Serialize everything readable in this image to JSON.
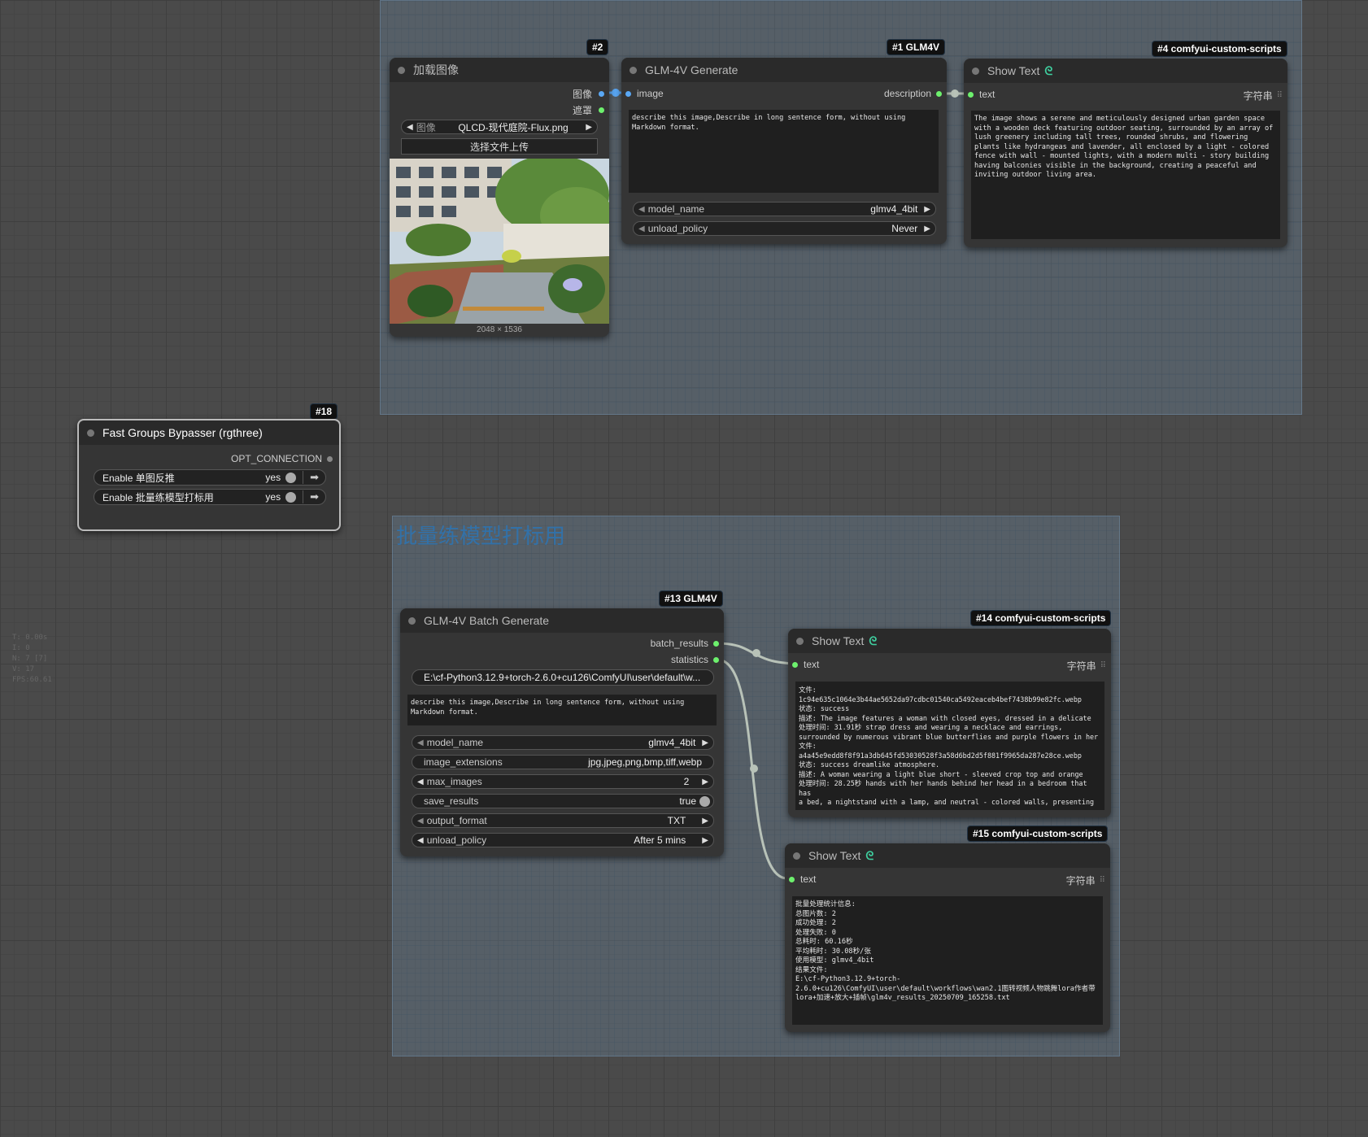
{
  "colors": {
    "wire": "#b8c2b8",
    "group_bg": "#7896b4",
    "link_green": "#6df06d",
    "link_blue": "#5aa8f5"
  },
  "stats": [
    "T: 0.00s",
    "I: 0",
    "N: 7 [7]",
    "V: 17",
    "FPS:60.61"
  ],
  "group_bottom": {
    "title": "批量练模型打标用"
  },
  "node_load_image": {
    "badge": "#2",
    "title": "加载图像",
    "out_image": "图像",
    "out_mask": "遮罩",
    "image_label": "图像",
    "image_value": "QLCD-现代庭院-Flux.png",
    "upload_button": "选择文件上传",
    "dimensions": "2048 × 1536"
  },
  "node_glm_generate": {
    "badge": "#1 GLM4V",
    "title": "GLM-4V Generate",
    "in_image": "image",
    "out_description": "description",
    "prompt": "describe this image,Describe in long sentence form, without using Markdown format.",
    "model_label": "model_name",
    "model_value": "glmv4_4bit",
    "unload_label": "unload_policy",
    "unload_value": "Never"
  },
  "node_show_text_4": {
    "badge": "#4 comfyui-custom-scripts",
    "title": "Show Text",
    "icon": "snake-icon",
    "in_text": "text",
    "type_label": "字符串",
    "content": "The image shows a serene and meticulously designed urban garden space with a wooden deck featuring outdoor seating, surrounded by an array of lush greenery including tall trees, rounded shrubs, and flowering plants like hydrangeas and lavender, all enclosed by a light - colored fence with wall - mounted lights, with a modern multi - story building having balconies visible in the background, creating a peaceful and inviting outdoor living area."
  },
  "node_bypasser": {
    "badge": "#18",
    "title": "Fast Groups Bypasser (rgthree)",
    "out_opt": "OPT_CONNECTION",
    "rows": [
      {
        "label": "Enable 单图反推",
        "value": "yes"
      },
      {
        "label": "Enable 批量练模型打标用",
        "value": "yes"
      }
    ]
  },
  "node_batch": {
    "badge": "#13 GLM4V",
    "title": "GLM-4V Batch Generate",
    "out_batch": "batch_results",
    "out_stats": "statistics",
    "path": "E:\\cf-Python3.12.9+torch-2.6.0+cu126\\ComfyUI\\user\\default\\w...",
    "prompt": "describe this image,Describe in long sentence form, without using Markdown format.",
    "widgets": [
      {
        "label": "model_name",
        "value": "glmv4_4bit",
        "type": "combo"
      },
      {
        "label": "image_extensions",
        "value": "jpg,jpeg,png,bmp,tiff,webp",
        "type": "text"
      },
      {
        "label": "max_images",
        "value": "2",
        "type": "number"
      },
      {
        "label": "save_results",
        "value": "true",
        "type": "toggle"
      },
      {
        "label": "output_format",
        "value": "TXT",
        "type": "combo"
      },
      {
        "label": "unload_policy",
        "value": "After 5 mins",
        "type": "combo"
      }
    ]
  },
  "node_show_text_14": {
    "badge": "#14 comfyui-custom-scripts",
    "title": "Show Text",
    "in_text": "text",
    "type_label": "字符串",
    "content": "文件: 1c94e635c1064e3b44ae5652da97cdbc01540ca5492eaceb4bef7438b99e82fc.webp\n状态: success\n描述: The image features a woman with closed eyes, dressed in a delicate\n处理时间: 31.91秒 strap dress and wearing a necklace and earrings,\nsurrounded by numerous vibrant blue butterflies and purple flowers in her\n文件: a4a45e9edd8f8f91a3db645fd53030528f3a58d6bd2d5f881f9965da287e28ce.webp\n状态: success dreamlike atmosphere.\n描述: A woman wearing a light blue short - sleeved crop top and orange\n处理时间: 28.25秒 hands with her hands behind her head in a bedroom that has\na bed, a nightstand with a lamp, and neutral - colored walls, presenting a\ncasual and confident appearance."
  },
  "node_show_text_15": {
    "badge": "#15 comfyui-custom-scripts",
    "title": "Show Text",
    "in_text": "text",
    "type_label": "字符串",
    "content": "批量处理统计信息:\n总图片数: 2\n成功处理: 2\n处理失败: 0\n总耗时: 60.16秒\n平均耗时: 30.08秒/张\n使用模型: glmv4_4bit\n结果文件:\nE:\\cf-Python3.12.9+torch-2.6.0+cu126\\ComfyUI\\user\\default\\workflows\\wan2.1图转视频人物跳舞lora作者带lora+加速+放大+插帧\\glm4v_results_20250709_165258.txt"
  }
}
